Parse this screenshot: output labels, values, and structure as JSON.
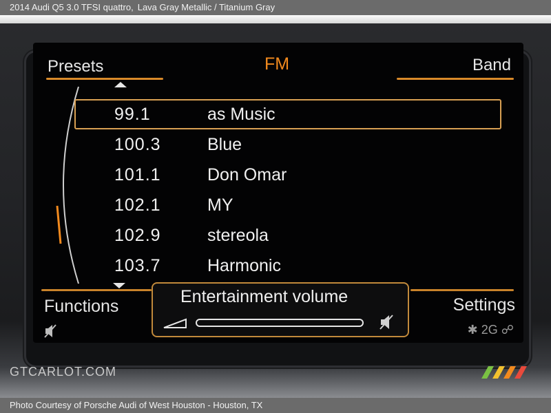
{
  "caption": {
    "title": "2014 Audi Q5 3.0 TFSI quattro,",
    "subtitle": "Lava Gray Metallic / Titanium Gray"
  },
  "footer": {
    "credit": "Photo Courtesy of Porsche Audi of West Houston - Houston, TX"
  },
  "watermark": {
    "text": "GTCARLOT.COM"
  },
  "radio": {
    "header": {
      "left": "Presets",
      "center": "FM",
      "right": "Band"
    },
    "stations": [
      {
        "freq": "99.1",
        "name": "as Music",
        "selected": true
      },
      {
        "freq": "100.3",
        "name": "Blue"
      },
      {
        "freq": "101.1",
        "name": "Don Omar"
      },
      {
        "freq": "102.1",
        "name": "MY"
      },
      {
        "freq": "102.9",
        "name": "stereola"
      },
      {
        "freq": "103.7",
        "name": "Harmonic"
      }
    ],
    "softkeys": {
      "left": "Functions",
      "right": "Settings"
    },
    "volume_popup": {
      "title": "Entertainment volume",
      "level": 0.0
    },
    "status": {
      "network": "2G"
    }
  },
  "colors": {
    "accent": "#f28a1e",
    "highlight": "#d9a053",
    "text": "#f0f0f0"
  }
}
